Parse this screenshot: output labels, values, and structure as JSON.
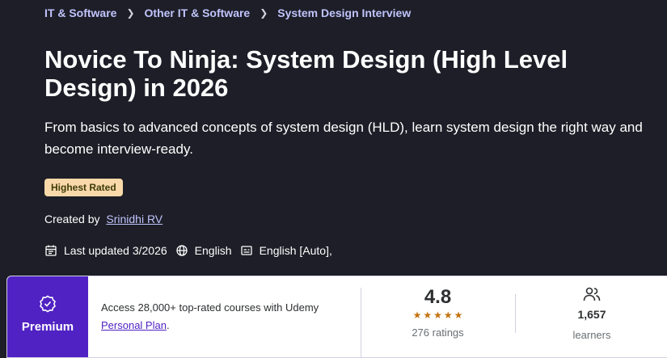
{
  "breadcrumb": [
    "IT & Software",
    "Other IT & Software",
    "System Design Interview"
  ],
  "course": {
    "title": "Novice To Ninja: System Design (High Level Design) in 2026",
    "subtitle": "From basics to advanced concepts of system design (HLD), learn system design the right way and become interview-ready.",
    "badge": "Highest Rated",
    "created_by_label": "Created by",
    "instructor": "Srinidhi RV",
    "last_updated": "Last updated 3/2026",
    "language": "English",
    "captions": "English [Auto],"
  },
  "card": {
    "premium_label": "Premium",
    "access_text": "Access 28,000+ top-rated courses with Udemy",
    "plan_link": "Personal Plan",
    "plan_suffix": ".",
    "rating": "4.8",
    "ratings_count": "276 ratings",
    "learners_count": "1,657",
    "learners_label": "learners"
  },
  "colors": {
    "background": "#1d1e27",
    "link": "#c0c4fc",
    "badge": "#f9d8a9",
    "premium": "#5022c3",
    "star": "#c4710d"
  },
  "icons": {
    "calendar": "calendar-icon",
    "globe": "globe-icon",
    "captions": "captions-icon",
    "premium": "premium-badge-icon",
    "learners": "users-icon",
    "chevron": "chevron-right-icon",
    "star": "star-icon"
  }
}
